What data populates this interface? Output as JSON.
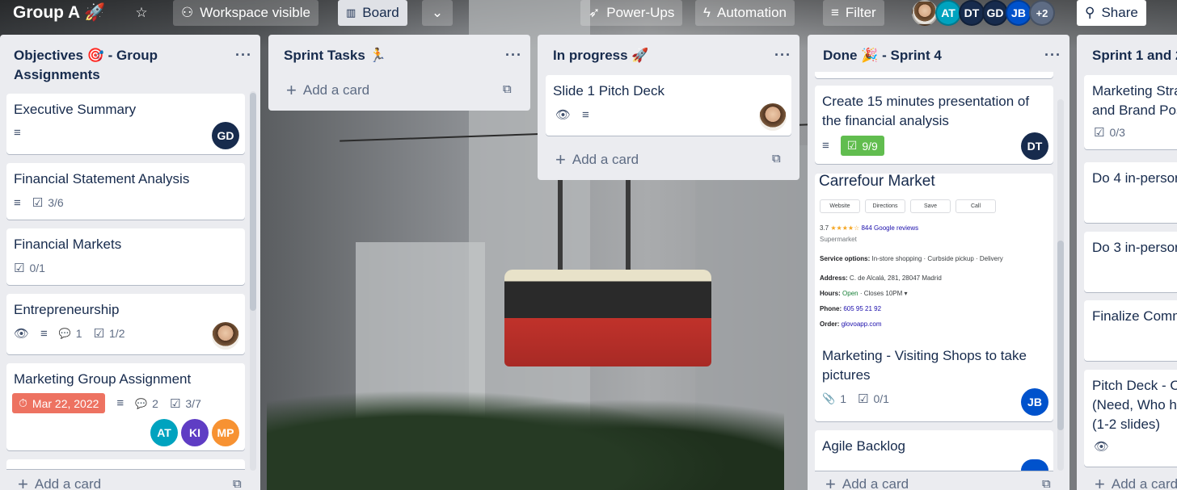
{
  "board": {
    "title": "Group A 🚀",
    "visibility": "Workspace visible",
    "view": "Board",
    "powerups": "Power-Ups",
    "automation": "Automation",
    "filter": "Filter",
    "share": "Share",
    "members": [
      {
        "initials": "",
        "color": "#8a6a4a"
      },
      {
        "initials": "AT",
        "color": "#00a3bf"
      },
      {
        "initials": "DT",
        "color": "#172b4d"
      },
      {
        "initials": "GD",
        "color": "#172b4d"
      },
      {
        "initials": "JB",
        "color": "#0052cc"
      }
    ],
    "more_members": "+2"
  },
  "lists": [
    {
      "title": "Objectives 🎯 - Group Assignments",
      "cards": [
        {
          "title": "Executive Summary",
          "member": "GD"
        },
        {
          "title": "Financial Statement Analysis",
          "checklist": "3/6"
        },
        {
          "title": "Financial Markets",
          "checklist": "0/1"
        },
        {
          "title": "Entrepreneurship",
          "comments": "1",
          "checklist": "1/2"
        },
        {
          "title": "Marketing Group Assignment",
          "due": "Mar 22, 2022",
          "comments": "2",
          "checklist": "3/7",
          "members": [
            "AT",
            "KI",
            "MP"
          ]
        }
      ],
      "add_card": "Add a card"
    },
    {
      "title": "Sprint Tasks 🏃",
      "cards": [],
      "add_card": "Add a card"
    },
    {
      "title": "In progress 🚀",
      "cards": [
        {
          "title": "Slide 1 Pitch Deck"
        }
      ],
      "add_card": "Add a card"
    },
    {
      "title": "Done 🎉 - Sprint 4",
      "cards": [
        {
          "title": "Create 15 minutes presentation of the financial analysis",
          "checklist": "9/9",
          "member": "DT"
        },
        {
          "title": "Marketing - Visiting Shops to take pictures",
          "attachments": "1",
          "checklist": "0/1",
          "member": "JB"
        },
        {
          "title": "Agile Backlog"
        }
      ],
      "cover": {
        "name": "Carrefour Market",
        "buttons": [
          "Website",
          "Directions",
          "Save",
          "Call"
        ],
        "rating": "3.7",
        "stars": "★★★★☆",
        "reviews": "844 Google reviews",
        "category": "Supermarket",
        "service_label": "Service options:",
        "service": "In-store shopping · Curbside pickup · Delivery",
        "address_label": "Address:",
        "address": "C. de Alcalá, 281, 28047 Madrid",
        "hours_label": "Hours:",
        "hours_open": "Open",
        "hours_rest": "· Closes 10PM ▾",
        "phone_label": "Phone:",
        "phone": "605 95 21 92",
        "order_label": "Order:",
        "order": "glovoapp.com"
      },
      "add_card": "Add a card"
    },
    {
      "title": "Sprint 1 and 2",
      "cards": [
        {
          "title": "Marketing Stra",
          "title2": "and Brand Pos",
          "checklist": "0/3"
        },
        {
          "title": "Do 4 in-persor"
        },
        {
          "title": "Do 3 in-persor"
        },
        {
          "title": "Finalize Comm"
        },
        {
          "title": "Pitch Deck - O",
          "title2": "(Need, Who ha",
          "title3": "(1-2 slides)"
        }
      ],
      "add_card": "Add a card"
    }
  ],
  "icons": {
    "description": "≡",
    "checklist": "☑",
    "comment": "💬",
    "watch": "👁",
    "attachment": "📎",
    "clock": "⏱",
    "template": "⧉",
    "plus": "+",
    "more": "···"
  }
}
